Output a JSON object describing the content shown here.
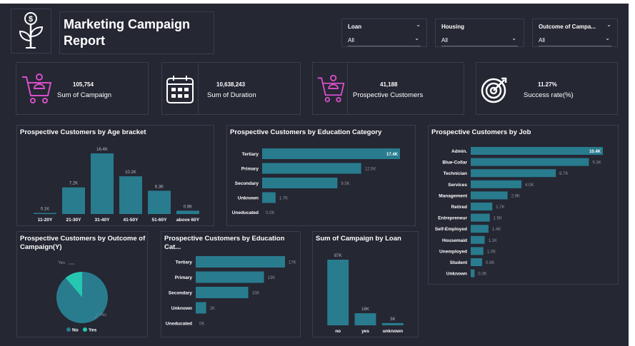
{
  "header": {
    "title_line1": "Marketing Campaign",
    "title_line2": "Report",
    "logo_icon": "dollar-plant-icon"
  },
  "slicers": [
    {
      "title": "Loan",
      "value": "All"
    },
    {
      "title": "Housing",
      "value": "All"
    },
    {
      "title": "Outcome of Campa...",
      "value": "All"
    }
  ],
  "kpis": [
    {
      "value": "105,754",
      "label": "Sum of Campaign",
      "icon": "shopping-cart-person-icon"
    },
    {
      "value": "10,638,243",
      "label": "Sum of Duration",
      "icon": "calendar-icon"
    },
    {
      "value": "41,188",
      "label": "Prospective Customers",
      "icon": "shopping-cart-person-icon"
    },
    {
      "value": "11.27%",
      "label": "Success rate(%)",
      "icon": "target-icon"
    }
  ],
  "colors": {
    "bar": "#287c8e",
    "yes": "#26c6b0",
    "kpi_icon": "#d84fc8",
    "background": "#252733"
  },
  "chart_data": [
    {
      "id": "age",
      "type": "bar",
      "title": "Prospective Customers by Age bracket",
      "categories": [
        "11-20Y",
        "21-30Y",
        "31-40Y",
        "41-50Y",
        "51-60Y",
        "above 60Y"
      ],
      "values": [
        0.1,
        7.2,
        16.4,
        10.2,
        6.3,
        0.9
      ],
      "data_labels": [
        "0.1K",
        "7.2K",
        "16.4K",
        "10.2K",
        "6.3K",
        "0.9K"
      ],
      "ylim": [
        0,
        16.4
      ]
    },
    {
      "id": "edu1",
      "type": "bar",
      "orientation": "horizontal",
      "title": "Prospective Customers by Education Category",
      "categories": [
        "Tertiary",
        "Primary",
        "Secondary",
        "Unknown",
        "Uneducated"
      ],
      "values": [
        17.4,
        12.5,
        9.5,
        1.7,
        0.0
      ],
      "data_labels": [
        "17.4K",
        "12.5K",
        "9.5K",
        "1.7K",
        "0.0K"
      ]
    },
    {
      "id": "job",
      "type": "bar",
      "orientation": "horizontal",
      "title": "Prospective Customers by Job",
      "categories": [
        "Admin.",
        "Blue-Collar",
        "Technician",
        "Services",
        "Management",
        "Retired",
        "Entrepreneur",
        "Self-Employed",
        "Housemaid",
        "Unemployed",
        "Student",
        "Unknown"
      ],
      "values": [
        10.4,
        9.3,
        6.7,
        4.0,
        2.9,
        1.7,
        1.5,
        1.4,
        1.1,
        1.0,
        0.9,
        0.3
      ],
      "data_labels": [
        "10.4K",
        "9.3K",
        "6.7K",
        "4.0K",
        "2.9K",
        "1.7K",
        "1.5K",
        "1.4K",
        "1.1K",
        "1.0K",
        "0.9K",
        "0.3K"
      ]
    },
    {
      "id": "outcome",
      "type": "pie",
      "title_line1": "Prospective Customers by Outcome of",
      "title_line2": "Campaign(Y)",
      "categories": [
        "No",
        "Yes"
      ],
      "values": [
        88.73,
        11.27
      ],
      "slice_labels": [
        "No",
        "Yes"
      ],
      "legend": [
        "No",
        "Yes"
      ],
      "legend_position": "bottom"
    },
    {
      "id": "edu2",
      "type": "bar",
      "orientation": "horizontal",
      "title": "Prospective Customers by Education Cat...",
      "categories": [
        "Tertiary",
        "Primary",
        "Secondary",
        "Unknown",
        "Uneducated"
      ],
      "values": [
        17,
        13,
        10,
        2,
        0
      ],
      "data_labels": [
        "17K",
        "13K",
        "10K",
        "2K",
        "0K"
      ]
    },
    {
      "id": "loan",
      "type": "bar",
      "title": "Sum of Campaign by Loan",
      "categories": [
        "no",
        "yes",
        "unknown"
      ],
      "values": [
        87,
        16,
        3
      ],
      "data_labels": [
        "87K",
        "16K",
        "3K"
      ]
    }
  ]
}
